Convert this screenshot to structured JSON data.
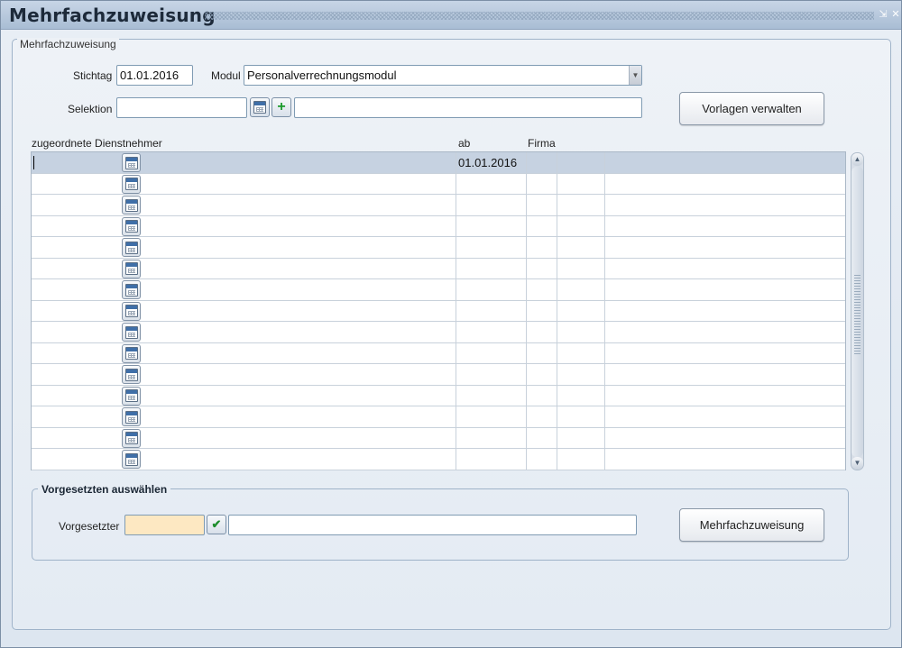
{
  "window": {
    "title": "Mehrfachzuweisung",
    "minimize_glyph": "⇲",
    "close_glyph": "✕"
  },
  "panel": {
    "legend": "Mehrfachzuweisung",
    "stichtag_label": "Stichtag",
    "stichtag_value": "01.01.2016",
    "modul_label": "Modul",
    "modul_value": "Personalverrechnungsmodul",
    "selektion_label": "Selektion",
    "selektion_value": "",
    "selektion_desc": "",
    "vorlagen_button": "Vorlagen verwalten"
  },
  "table": {
    "headers": {
      "dienstnehmer": "zugeordnete Dienstnehmer",
      "ab": "ab",
      "firma": "Firma"
    },
    "rows": [
      {
        "ab": "01.01.2016",
        "selected": true
      },
      {
        "ab": ""
      },
      {
        "ab": ""
      },
      {
        "ab": ""
      },
      {
        "ab": ""
      },
      {
        "ab": ""
      },
      {
        "ab": ""
      },
      {
        "ab": ""
      },
      {
        "ab": ""
      },
      {
        "ab": ""
      },
      {
        "ab": ""
      },
      {
        "ab": ""
      },
      {
        "ab": ""
      },
      {
        "ab": ""
      },
      {
        "ab": ""
      }
    ]
  },
  "vorgesetzter": {
    "legend": "Vorgesetzten auswählen",
    "label": "Vorgesetzter",
    "code_value": "",
    "name_value": "",
    "button": "Mehrfachzuweisung"
  },
  "colors": {
    "title_bg": "#b3c5d9",
    "selected_row": "#c6d2e1",
    "required_field": "#fde8c2"
  },
  "icons": {
    "calendar_lookup": "calendar-icon",
    "add": "plus-icon",
    "confirm": "checkmark-icon"
  }
}
